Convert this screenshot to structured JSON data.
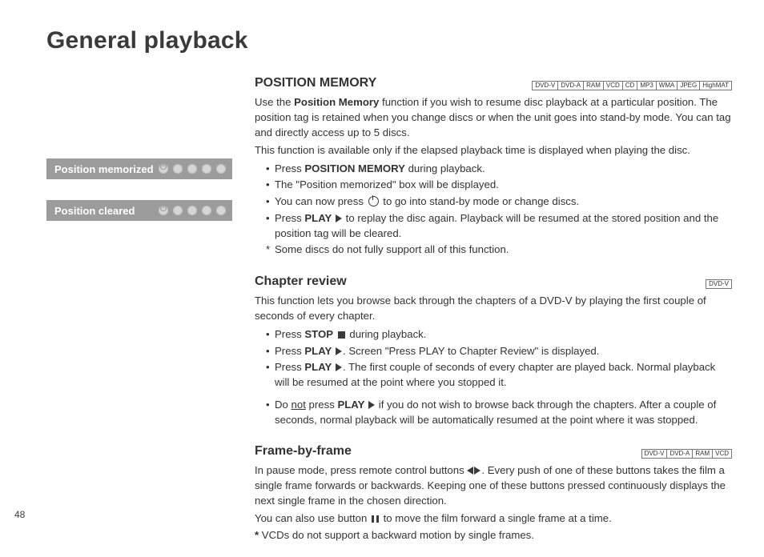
{
  "page_number": "48",
  "title": "General playback",
  "sidebar": {
    "status_boxes": [
      {
        "label": "Position memorized"
      },
      {
        "label": "Position cleared"
      }
    ]
  },
  "sections": {
    "position_memory": {
      "heading": "POSITION MEMORY",
      "badges": [
        "DVD-V",
        "DVD-A",
        "RAM",
        "VCD",
        "CD",
        "MP3",
        "WMA",
        "JPEG",
        "HighMAT"
      ],
      "intro": [
        "Use the ",
        "Position Memory",
        " function if you wish to resume disc playback at a particular position. The position tag is retained when you change discs or when the unit goes into stand-by mode. You can tag and directly access up to 5 discs."
      ],
      "note": "This function is available only if the elapsed playback time is displayed when playing the disc.",
      "bullets": {
        "b1a": "Press ",
        "b1b": "POSITION MEMORY",
        "b1c": " during playback.",
        "b2": "The \"Position memorized\" box will be displayed.",
        "b3a": "You can now press ",
        "b3b": " to go into stand-by mode or change discs.",
        "b4a": "Press ",
        "b4b": "PLAY",
        "b4c": " to replay the disc again. Playback will be resumed at the stored position and the position tag will be cleared.",
        "b5": "Some discs do not fully support all of this function."
      }
    },
    "chapter_review": {
      "heading": "Chapter review",
      "badges": [
        "DVD-V"
      ],
      "intro": "This function lets you browse back through the chapters of a DVD-V by playing the first couple of seconds of every chapter.",
      "bullets": {
        "b1a": "Press ",
        "b1b": "STOP",
        "b1c": "  during playback.",
        "b2a": "Press ",
        "b2b": "PLAY",
        "b2c": ". Screen \"Press PLAY to Chapter Review\" is displayed.",
        "b3a": "Press ",
        "b3b": "PLAY",
        "b3c": ". The first couple of seconds of every chapter are played back. Normal playback will be resumed at the point where you stopped it.",
        "b4a": "Do ",
        "b4not": "not",
        "b4b": " press ",
        "b4c": "PLAY",
        "b4d": " if you do not wish to browse back through the chapters. After a couple of seconds, normal playback will be automatically resumed at the point where it was stopped."
      }
    },
    "frame_by_frame": {
      "heading": "Frame-by-frame",
      "badges": [
        "DVD-V",
        "DVD-A",
        "RAM",
        "VCD"
      ],
      "p1a": "In pause mode, press remote control buttons ",
      "p1b": ". Every push of one of these buttons takes the film a single frame forwards or backwards. Keeping one of these buttons pressed continuously displays the next single frame in the chosen direction.",
      "p2a": "You can also use button ",
      "p2b": " to move the film forward a single frame at a time.",
      "star": " VCDs do not support a backward motion by single frames."
    }
  }
}
